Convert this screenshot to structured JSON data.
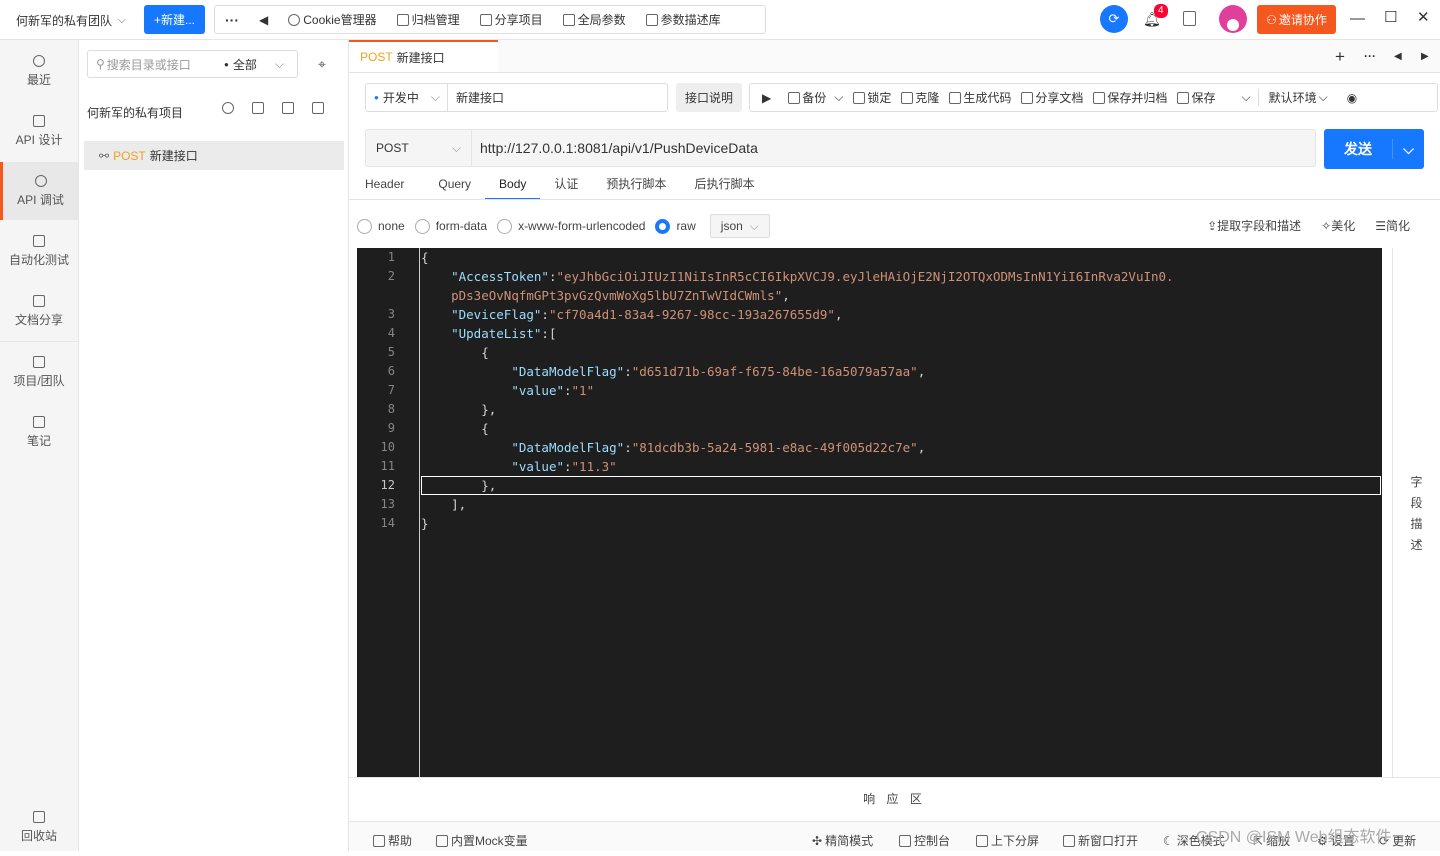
{
  "topbar": {
    "team_name": "何新军的私有团队",
    "new_button": "+新建...",
    "more": "···",
    "back": "◀",
    "tools": [
      "Cookie管理器",
      "归档管理",
      "分享项目",
      "全局参数",
      "参数描述库"
    ],
    "notification_count": "4",
    "invite_label": "邀请协作"
  },
  "leftnav": {
    "items": [
      {
        "label": "最近"
      },
      {
        "label": "API 设计"
      },
      {
        "label": "API 调试"
      },
      {
        "label": "自动化测试"
      },
      {
        "label": "文档分享"
      },
      {
        "label": "项目/团队"
      },
      {
        "label": "笔记"
      }
    ],
    "trash_label": "回收站"
  },
  "tree": {
    "search_placeholder": "搜索目录或接口",
    "filter_value": "全部",
    "project_title": "何新军的私有项目",
    "item_method": "POST",
    "item_name": "新建接口"
  },
  "tab": {
    "method": "POST",
    "name": "新建接口"
  },
  "request": {
    "status": "开发中",
    "name_value": "新建接口",
    "desc_button": "接口说明",
    "actions": [
      "备份",
      "锁定",
      "克隆",
      "生成代码",
      "分享文档",
      "保存并归档",
      "保存"
    ],
    "environment": "默认环境",
    "method": "POST",
    "url": "http://127.0.0.1:8081/api/v1/PushDeviceData",
    "send_label": "发送"
  },
  "subtabs": [
    "Header",
    "Query",
    "Body",
    "认证",
    "预执行脚本",
    "后执行脚本"
  ],
  "body": {
    "options": [
      "none",
      "form-data",
      "x-www-form-urlencoded",
      "raw"
    ],
    "format": "json",
    "right_actions": [
      "提取字段和描述",
      "美化",
      "简化"
    ]
  },
  "editor": {
    "line_numbers": [
      "1",
      "2",
      "",
      "3",
      "4",
      "5",
      "6",
      "7",
      "8",
      "9",
      "10",
      "11",
      "12",
      "13",
      "14"
    ],
    "current_line": "12"
  },
  "field_desc_label": [
    "字",
    "段",
    "描",
    "述"
  ],
  "response_label": "响 应 区",
  "bottombar": {
    "left": [
      "帮助",
      "内置Mock变量"
    ],
    "right": [
      "精简模式",
      "控制台",
      "上下分屏",
      "新窗口打开",
      "深色模式",
      "缩放",
      "设置",
      "更新"
    ]
  },
  "watermark": "CSDN @ISM Web组态软件"
}
